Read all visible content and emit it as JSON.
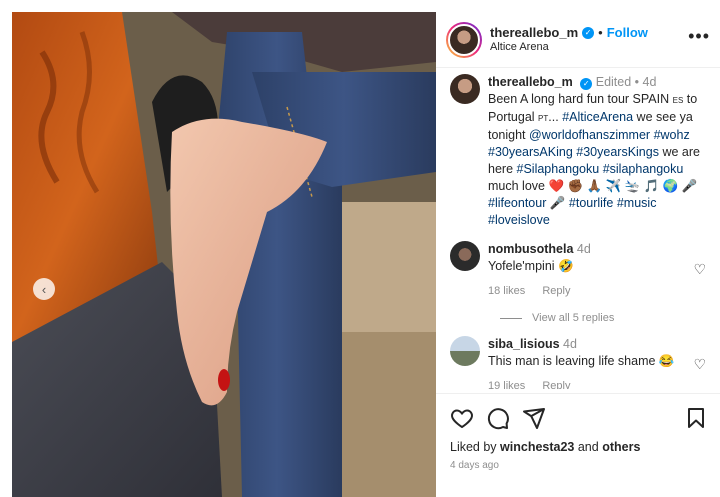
{
  "post": {
    "username": "thereallebo_m",
    "location": "Altice Arena",
    "follow_label": "Follow",
    "dot": "•",
    "more_icon": "more-horizontal-icon",
    "verified_glyph": "✓"
  },
  "caption": {
    "username": "thereallebo_m",
    "edited": "Edited",
    "age": "4d",
    "text_1": "Been A long hard fun tour SPAIN",
    "flag_es": "ES",
    "text_2": "to Portugal",
    "flag_pt": "PT",
    "text_3": "... ",
    "tag_altice": "#AlticeArena",
    "text_4": " we see ya tonight ",
    "tag_wohz_user": "@worldofhanszimmer",
    "text_5": " ",
    "tag_wohz": "#wohz",
    "text_6": " ",
    "tag_30king": "#30yearsAKing",
    "text_7": " ",
    "tag_30kings": "#30yearsKings",
    "text_8": " we are here ",
    "tag_sila1": "#Silaphangoku",
    "text_9": " ",
    "tag_sila2": "#silaphangoku",
    "text_10": " much love ",
    "emojis_1": "❤️ ✊🏾 🙏🏾 ✈️ 🛬 🎵 🌍 🎤",
    "tag_lifeontour": "#lifeontour",
    "emoji_mic": " 🎤 ",
    "tag_tourlife": "#tourlife",
    "text_11": " ",
    "tag_music": "#music",
    "tag_loveislove": "#loveislove"
  },
  "comments": [
    {
      "username": "nombusothela",
      "age": "4d",
      "text": "Yofele'mpini 🤣",
      "likes": "18 likes",
      "reply": "Reply"
    },
    {
      "username": "siba_lisious",
      "age": "4d",
      "text": "This man is leaving life shame 😂",
      "likes": "19 likes",
      "reply": "Reply"
    }
  ],
  "view_replies": "View all 5 replies",
  "footer": {
    "liked_by_prefix": "Liked by ",
    "liked_by_user": "winchesta23",
    "liked_by_and": " and ",
    "liked_by_others": "others",
    "date": "4 days ago"
  },
  "nav": {
    "prev_glyph": "‹"
  },
  "colors": {
    "accent": "#0095f6",
    "tag": "#00376b",
    "muted": "#8e8e8e"
  }
}
